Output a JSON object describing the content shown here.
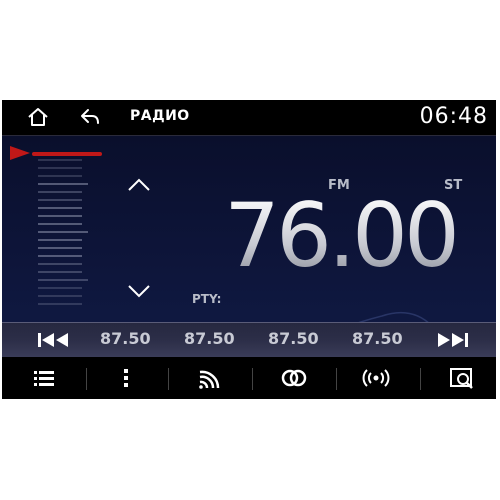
{
  "header": {
    "title": "РАДИО",
    "clock": "06:48"
  },
  "tuner": {
    "band": "FM",
    "stereo": "ST",
    "frequency": "76.00",
    "pty_label": "PTY:"
  },
  "presets": [
    {
      "label": "87.50"
    },
    {
      "label": "87.50"
    },
    {
      "label": "87.50"
    },
    {
      "label": "87.50"
    }
  ],
  "icons": {
    "home": "home-icon",
    "back": "back-icon",
    "up": "chevron-up-icon",
    "down": "chevron-down-icon",
    "prev": "skip-previous-icon",
    "next": "skip-next-icon",
    "list": "list-icon",
    "menu": "more-vertical-icon",
    "rds": "signal-icon",
    "stereo": "stereo-icon",
    "af": "broadcast-icon",
    "ta": "traffic-info-icon"
  },
  "colors": {
    "accent": "#c01818",
    "background": "#0d1438"
  }
}
